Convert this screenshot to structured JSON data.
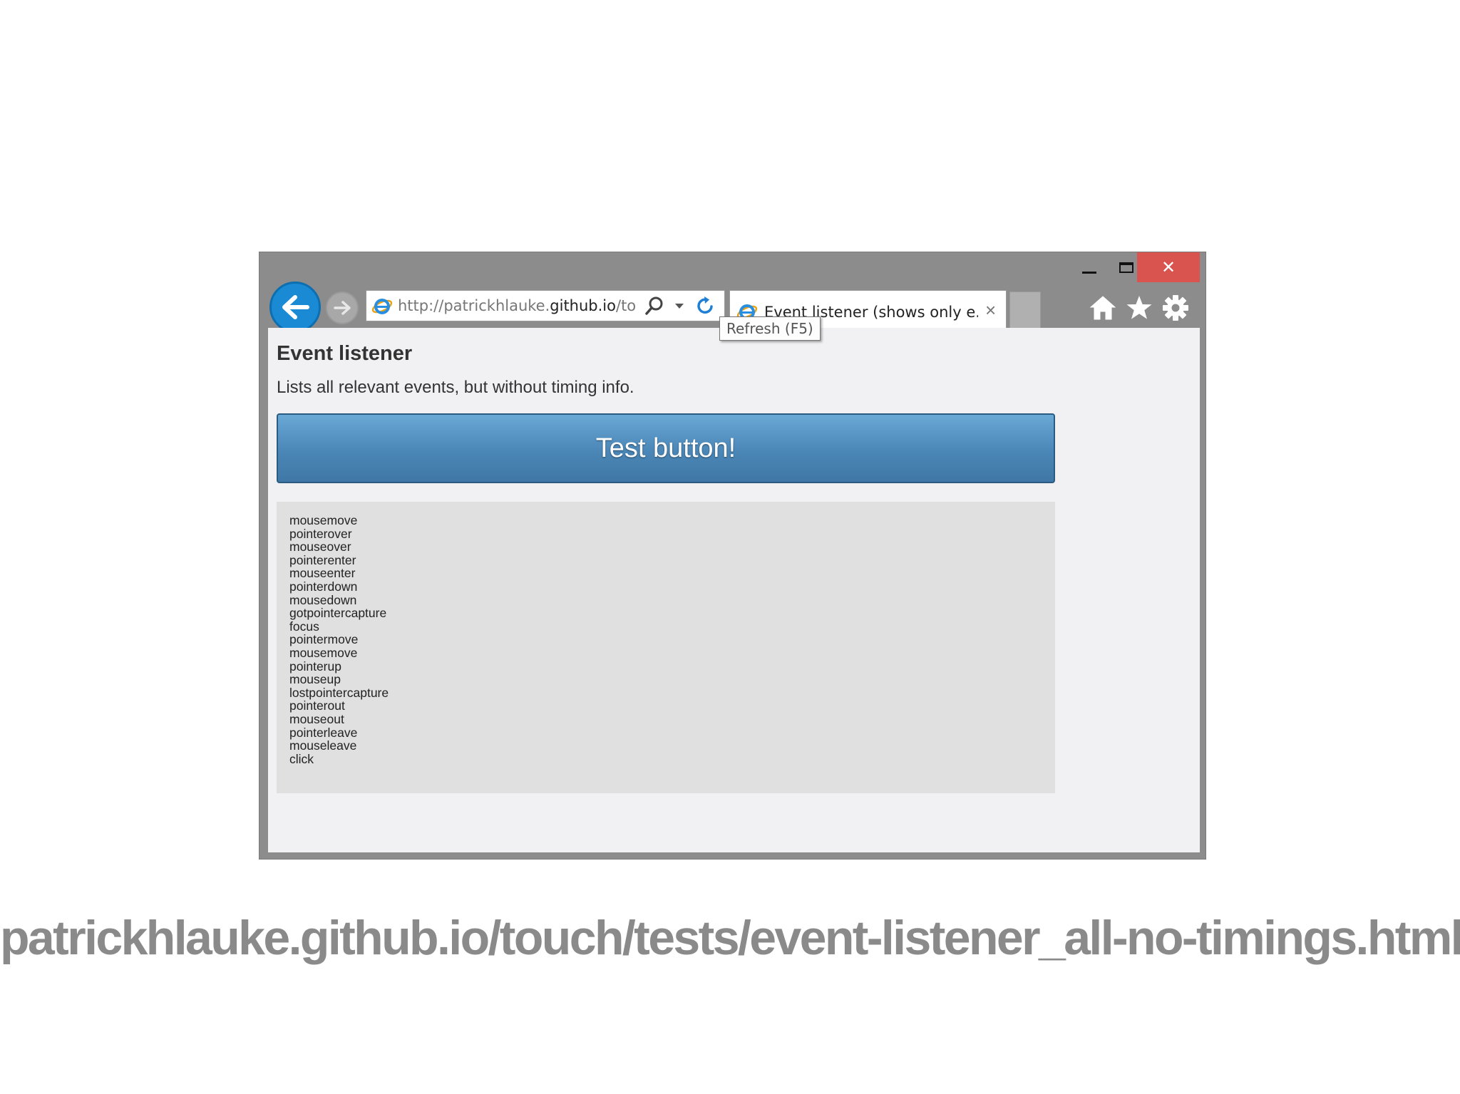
{
  "browser": {
    "address_url_prefix": "http://patrickhlauke.",
    "address_url_domain": "github.io",
    "address_url_suffix": "/to",
    "tab_title": "Event listener (shows only e...",
    "tab_close": "×",
    "tooltip": "Refresh (F5)",
    "close_glyph": "✕"
  },
  "page": {
    "title": "Event listener",
    "description": "Lists all relevant events, but without timing info.",
    "button_label": "Test button!",
    "events": [
      "mousemove",
      "pointerover",
      "mouseover",
      "pointerenter",
      "mouseenter",
      "pointerdown",
      "mousedown",
      "gotpointercapture",
      "focus",
      "pointermove",
      "mousemove",
      "pointerup",
      "mouseup",
      "lostpointercapture",
      "pointerout",
      "mouseout",
      "pointerleave",
      "mouseleave",
      "click"
    ]
  },
  "footer": {
    "url": "patrickhlauke.github.io/touch/tests/event-listener_all-no-timings.html"
  },
  "colors": {
    "close_button": "#d9534f",
    "back_button": "#1a8ad4",
    "test_button": "#4a86b6",
    "log_background": "#e0e0e0"
  },
  "icons": [
    "back-arrow-icon",
    "forward-arrow-icon",
    "ie-logo-icon",
    "search-icon",
    "dropdown-arrow-icon",
    "refresh-icon",
    "home-icon",
    "star-icon",
    "gear-icon"
  ]
}
